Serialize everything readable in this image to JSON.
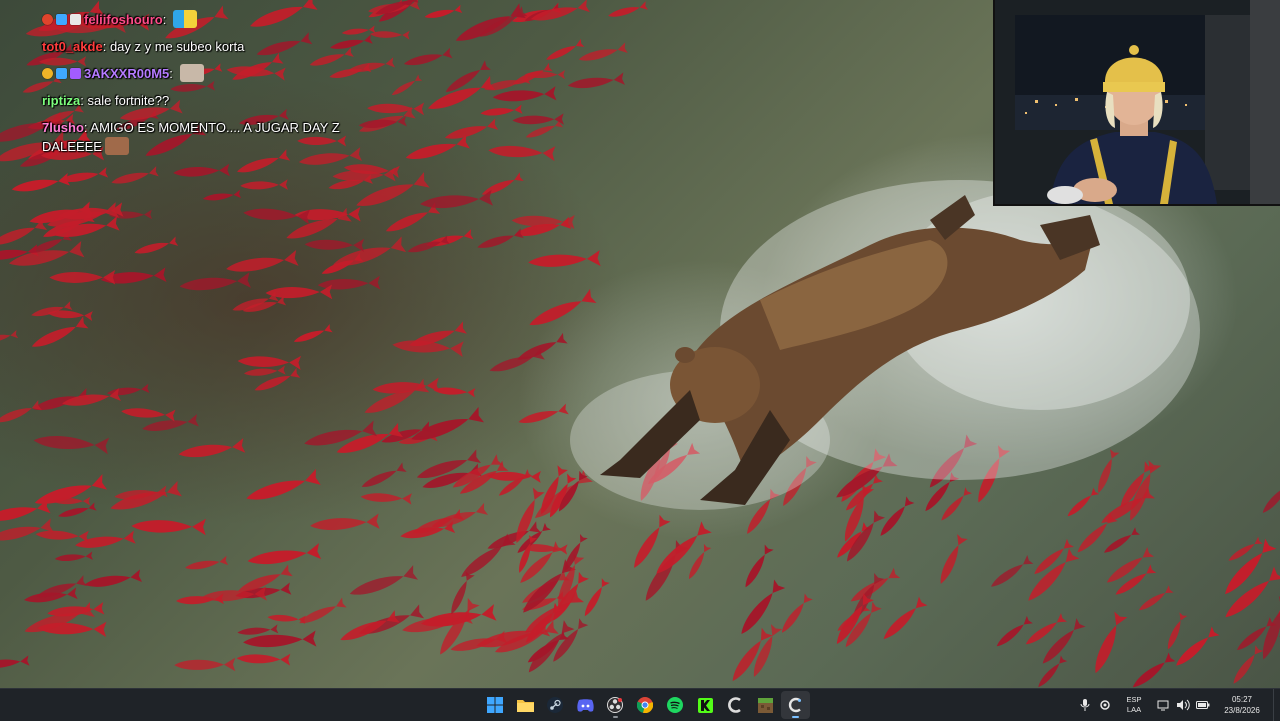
{
  "chat": {
    "messages": [
      {
        "user": "feliifoshouro",
        "text": "",
        "color": "#ff4d8a",
        "badges": [
          "red-dot",
          "cube",
          "prime"
        ],
        "emote": "pokemon-emote"
      },
      {
        "user": "tot0_akde",
        "text": "day z y me subeo korta",
        "color": "#ff3d3d",
        "badges": [],
        "emote": ""
      },
      {
        "user": "3AKXXR00M5",
        "text": "",
        "color": "#b57bff",
        "badges": [
          "gold-dot",
          "cube",
          "sub"
        ],
        "emote": "face-emote"
      },
      {
        "user": "riptiza",
        "text": "sale fortnite??",
        "color": "#7dff7d",
        "badges": [],
        "emote": ""
      },
      {
        "user": "7lusho",
        "text": "AMIGO ES MOMENTO.... A JUGAR DAY Z DALEEEE",
        "color": "#ff7fd4",
        "badges": [],
        "emote": "face-emote-2"
      }
    ]
  },
  "wallpaper": {
    "subject": "bear chasing sockeye salmon in river"
  },
  "webcam": {
    "subject": "streamer with beanie and jersey"
  },
  "taskbar": {
    "apps": [
      {
        "name": "start-icon",
        "state": ""
      },
      {
        "name": "file-explorer-icon",
        "state": ""
      },
      {
        "name": "steam-icon",
        "state": ""
      },
      {
        "name": "discord-icon",
        "state": ""
      },
      {
        "name": "obs-icon",
        "state": "open"
      },
      {
        "name": "chrome-icon",
        "state": ""
      },
      {
        "name": "spotify-icon",
        "state": ""
      },
      {
        "name": "kick-icon",
        "state": ""
      },
      {
        "name": "ccleaner-icon",
        "state": ""
      },
      {
        "name": "minecraft-icon",
        "state": ""
      },
      {
        "name": "app-c-icon",
        "state": "active"
      }
    ],
    "tray": {
      "lang_top": "ESP",
      "lang_bottom": "LAA",
      "time": "05:27",
      "date": "23/8/2026"
    }
  },
  "colors": {
    "taskbar_bg": "#1f2328",
    "accent": "#7cc1ff"
  }
}
